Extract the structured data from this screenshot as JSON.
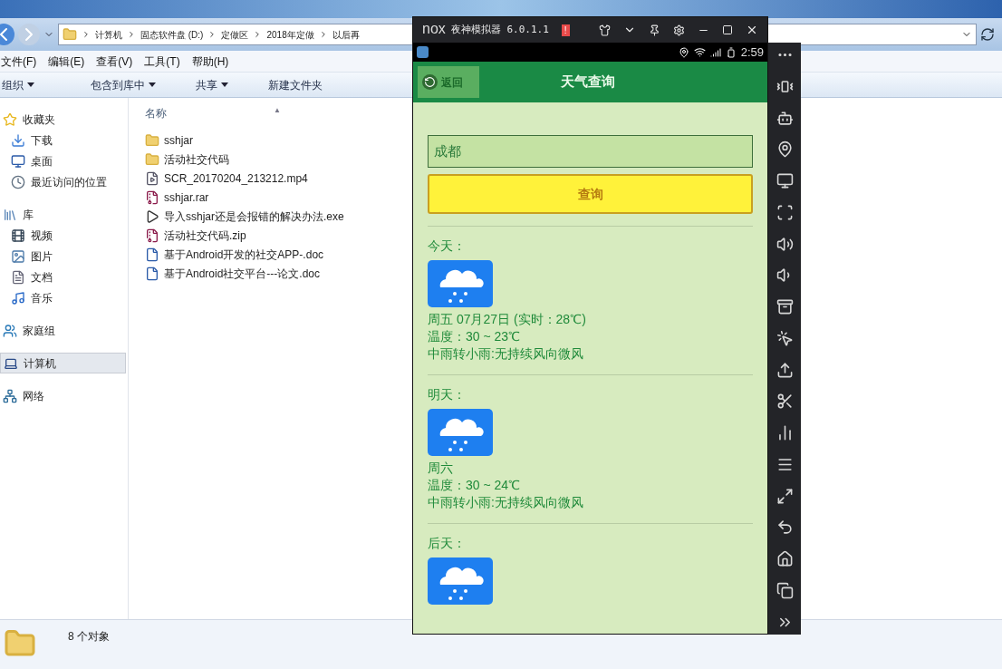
{
  "explorer": {
    "address_path": [
      "计算机",
      "固态软件盘 (D:)",
      "定做区",
      "2018年定做",
      "以后再"
    ],
    "menu": [
      "文件(F)",
      "编辑(E)",
      "查看(V)",
      "工具(T)",
      "帮助(H)"
    ],
    "toolbar": [
      {
        "label": "组织",
        "dropdown": true
      },
      {
        "label": "包含到库中",
        "dropdown": true
      },
      {
        "label": "共享",
        "dropdown": true
      },
      {
        "label": "新建文件夹",
        "dropdown": false
      }
    ],
    "sidebar": [
      {
        "label": "收藏夹",
        "kind": "favorites",
        "selected": false,
        "children": [
          {
            "label": "下载",
            "kind": "download",
            "selected": false
          },
          {
            "label": "桌面",
            "kind": "desktop",
            "selected": false
          },
          {
            "label": "最近访问的位置",
            "kind": "recent",
            "selected": false
          }
        ]
      },
      {
        "label": "库",
        "kind": "library",
        "selected": false,
        "children": [
          {
            "label": "视频",
            "kind": "video",
            "selected": false
          },
          {
            "label": "图片",
            "kind": "picture",
            "selected": false
          },
          {
            "label": "文档",
            "kind": "document",
            "selected": false
          },
          {
            "label": "音乐",
            "kind": "music",
            "selected": false
          }
        ]
      },
      {
        "label": "家庭组",
        "kind": "homegroup",
        "selected": false
      },
      {
        "label": "计算机",
        "kind": "computer",
        "selected": true
      },
      {
        "label": "网络",
        "kind": "network",
        "selected": false
      }
    ],
    "column_header": "名称",
    "sort_indicator": "▲",
    "files": [
      {
        "name": "sshjar",
        "kind": "folder"
      },
      {
        "name": "活动社交代码",
        "kind": "folder"
      },
      {
        "name": "SCR_20170204_213212.mp4",
        "kind": "video"
      },
      {
        "name": "sshjar.rar",
        "kind": "archive"
      },
      {
        "name": "导入sshjar还是会报错的解决办法.exe",
        "kind": "exe"
      },
      {
        "name": "活动社交代码.zip",
        "kind": "archive"
      },
      {
        "name": "基于Android开发的社交APP-.doc",
        "kind": "doc"
      },
      {
        "name": "基于Android社交平台---论文.doc",
        "kind": "doc"
      }
    ],
    "status": "8 个对象"
  },
  "emulator": {
    "logo": "nox",
    "title": "夜神模拟器 6.0.1.1",
    "alert": "!",
    "time": "2:59",
    "app": {
      "back": "返回",
      "title": "天气查询",
      "city": "成都",
      "button": "查询",
      "days": [
        {
          "label": "今天：",
          "date": "周五 07月27日 (实时：28℃)",
          "temp": "温度：30 ~ 23℃",
          "desc": "中雨转小雨:无持续风向微风"
        },
        {
          "label": "明天：",
          "date": "周六",
          "temp": "温度：30 ~ 24℃",
          "desc": "中雨转小雨:无持续风向微风"
        },
        {
          "label": "后天："
        }
      ]
    }
  }
}
